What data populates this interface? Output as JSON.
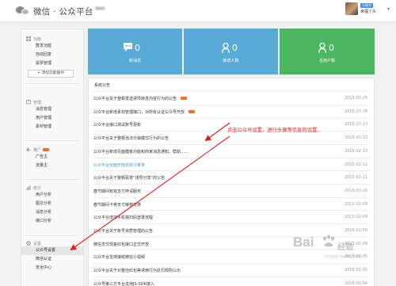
{
  "header": {
    "app_title": "微信 · 公众平台",
    "beta_badge": "beta",
    "user_badge": "订阅号",
    "user_name": "幸福丫头",
    "caret": "▾"
  },
  "sidebar": {
    "add_button_label": "+ 添加功能插件",
    "groups": [
      {
        "title": "功能",
        "icon": "grid-icon",
        "items": [
          "群发功能",
          "自动回复",
          "投票管理"
        ]
      },
      {
        "title": "管理",
        "icon": "manage-icon",
        "items": [
          "消息管理",
          "用户管理",
          "素材管理"
        ]
      },
      {
        "title": "推广",
        "icon": "promote-icon",
        "badge": "new",
        "items": [
          "广告主",
          "流量主"
        ]
      },
      {
        "title": "统计",
        "icon": "stats-icon",
        "items": [
          "用户分析",
          "图文分析",
          "消息分析",
          "接口分析"
        ]
      },
      {
        "title": "设置",
        "icon": "settings-icon",
        "items": [
          "公众号设置",
          "微信认证",
          "安全中心"
        ]
      }
    ],
    "active_item": "公众号设置"
  },
  "stats": [
    {
      "value": "0",
      "label": "新消息",
      "icon": "message-icon"
    },
    {
      "value": "0",
      "label": "新增人数",
      "icon": "user-icon"
    },
    {
      "value": "0",
      "label": "总用户数",
      "icon": "user-icon"
    }
  ],
  "notices": {
    "title": "系统公告",
    "rows": [
      {
        "text": "公众平台关于整顿发送诱导转发内容行为的公告",
        "date": "2015-03-25",
        "is_new": true,
        "link": false
      },
      {
        "text": "公众平台新增素材管理接口，对所有认证公众号开放",
        "date": "2015-03-18",
        "is_new": true,
        "link": false
      },
      {
        "text": "公众平台接口测试账号更新",
        "date": "2015-03-13",
        "is_new": false,
        "link": false
      },
      {
        "text": "公众平台关于整顿违法分销模式行为的公告",
        "date": "2015-03-13",
        "is_new": false,
        "link": false
      },
      {
        "text": "公众平台新增页面模板功能和商家消息通知，帮助……",
        "date": "2015-02-13",
        "is_new": false,
        "link": false
      },
      {
        "text": "公众平台全面开放自定义菜单",
        "date": "2015-02-12",
        "is_new": false,
        "link": true
      },
      {
        "text": "公众平台关于整顿恶意“诱导分享”的公告",
        "date": "2015-02-11",
        "is_new": false,
        "link": false
      },
      {
        "text": "春节期间有效支付申请服务",
        "date": "2015-02-10",
        "is_new": false,
        "link": false
      },
      {
        "text": "春节期间卡券支付审核安排",
        "date": "2015-02-09",
        "is_new": false,
        "link": false
      },
      {
        "text": "公众平台增加手机端扫码登录流程",
        "date": "2015-02-09",
        "is_new": false,
        "link": false
      },
      {
        "text": "公众平台关于账号资质管理的公告",
        "date": "2015-02-09",
        "is_new": false,
        "link": false
      },
      {
        "text": "微信支付现金红包接口正式开放",
        "date": "2015-02-09",
        "is_new": false,
        "link": false
      },
      {
        "text": "公众平台支持接收微信小视频",
        "date": "2015-02-05",
        "is_new": false,
        "link": false
      },
      {
        "text": "公众平台关于对整治红包等诱用行为处罚规则公示",
        "date": "2015-02-05",
        "is_new": false,
        "link": false
      },
      {
        "text": "公众号第三方平台支持JS-SDK接入",
        "date": "2015-02-04",
        "is_new": false,
        "link": false
      }
    ]
  },
  "annotation": "点击公众号设置，进行头像等信息的设置。",
  "watermark": {
    "brand": "Bai",
    "sub": "经验",
    "url": "jingyan.baidu.com"
  },
  "colors": {
    "tile_blue": "#5aaad8",
    "tile_green": "#4cb660",
    "annotation_red": "#e02020",
    "active_bg": "#e6e6e6",
    "new_tag": "#e6732e"
  }
}
